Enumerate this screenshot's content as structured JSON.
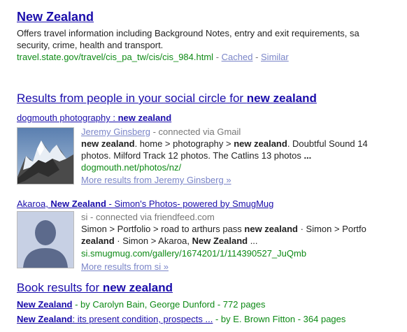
{
  "result1": {
    "title": "New Zealand",
    "snippet_line1": "Offers travel information including Background Notes, entry and exit requirements, sa",
    "snippet_line2": "security, crime, health and transport.",
    "url": "travel.state.gov/travel/cis_pa_tw/cis/cis_984.html",
    "sep1": " - ",
    "cached": "Cached",
    "sep2": " - ",
    "similar": "Similar"
  },
  "social": {
    "heading_prefix": "Results from people in your social circle for ",
    "heading_query": "new zealand",
    "item1": {
      "title_prefix": "dogmouth photography : ",
      "title_query": "new zealand",
      "author": "Jeremy Ginsberg",
      "via": " - connected via Gmail",
      "line1_a": "new zealand",
      "line1_b": ". home > photography > ",
      "line1_c": "new zealand",
      "line1_d": ". Doubtful Sound 14",
      "line2": "photos. Milford Track 12 photos. The Catlins 13 photos ",
      "line2_end": "...",
      "url": "dogmouth.net/photos/nz/",
      "more": "More results from Jeremy Ginsberg »"
    },
    "item2": {
      "title_a": "Akaroa, ",
      "title_b": "New Zealand",
      "title_c": " - Simon's Photos- powered by SmugMug",
      "author": "si",
      "via": " - connected via friendfeed.com",
      "line1_a": "Simon > Portfolio > road to arthurs pass ",
      "line1_b": "new zealand",
      "line1_c": " · Simon > Portfo",
      "line2_a": "zealand",
      "line2_b": " · Simon > Akaroa, ",
      "line2_c": "New Zealand",
      "line2_d": " ...",
      "url": "si.smugmug.com/gallery/1674201/1/114390527_JuQmb",
      "more": "More results from si »"
    }
  },
  "books": {
    "heading_prefix": "Book results for ",
    "heading_query": "new zealand",
    "items": [
      {
        "title": "New Zealand",
        "rest": "",
        "by": " - by Carolyn Bain, George Dunford - 772 pages"
      },
      {
        "title": "New Zealand",
        "rest": ": its present condition, prospects ...",
        "by": " - by E. Brown Fitton - 364 pages"
      }
    ]
  }
}
